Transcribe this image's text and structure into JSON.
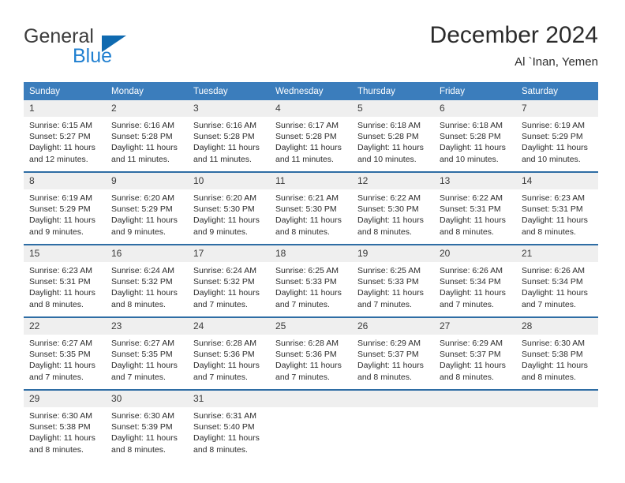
{
  "brand": {
    "name_part1": "General",
    "name_part2": "Blue",
    "logo_icon": "triangle-flag-icon"
  },
  "header": {
    "title": "December 2024",
    "subtitle": "Al `Inan, Yemen"
  },
  "colors": {
    "header_blue": "#3b7dbc",
    "separator_blue": "#2e6da4",
    "daynum_band": "#efefef",
    "brand_blue": "#1f7fd0",
    "logo_blue": "#0f6ab0",
    "text": "#2c2c2c"
  },
  "weekday_headers": [
    "Sunday",
    "Monday",
    "Tuesday",
    "Wednesday",
    "Thursday",
    "Friday",
    "Saturday"
  ],
  "weeks": [
    [
      {
        "day": "1",
        "sunrise": "Sunrise: 6:15 AM",
        "sunset": "Sunset: 5:27 PM",
        "daylight_line1": "Daylight: 11 hours",
        "daylight_line2": "and 12 minutes."
      },
      {
        "day": "2",
        "sunrise": "Sunrise: 6:16 AM",
        "sunset": "Sunset: 5:28 PM",
        "daylight_line1": "Daylight: 11 hours",
        "daylight_line2": "and 11 minutes."
      },
      {
        "day": "3",
        "sunrise": "Sunrise: 6:16 AM",
        "sunset": "Sunset: 5:28 PM",
        "daylight_line1": "Daylight: 11 hours",
        "daylight_line2": "and 11 minutes."
      },
      {
        "day": "4",
        "sunrise": "Sunrise: 6:17 AM",
        "sunset": "Sunset: 5:28 PM",
        "daylight_line1": "Daylight: 11 hours",
        "daylight_line2": "and 11 minutes."
      },
      {
        "day": "5",
        "sunrise": "Sunrise: 6:18 AM",
        "sunset": "Sunset: 5:28 PM",
        "daylight_line1": "Daylight: 11 hours",
        "daylight_line2": "and 10 minutes."
      },
      {
        "day": "6",
        "sunrise": "Sunrise: 6:18 AM",
        "sunset": "Sunset: 5:28 PM",
        "daylight_line1": "Daylight: 11 hours",
        "daylight_line2": "and 10 minutes."
      },
      {
        "day": "7",
        "sunrise": "Sunrise: 6:19 AM",
        "sunset": "Sunset: 5:29 PM",
        "daylight_line1": "Daylight: 11 hours",
        "daylight_line2": "and 10 minutes."
      }
    ],
    [
      {
        "day": "8",
        "sunrise": "Sunrise: 6:19 AM",
        "sunset": "Sunset: 5:29 PM",
        "daylight_line1": "Daylight: 11 hours",
        "daylight_line2": "and 9 minutes."
      },
      {
        "day": "9",
        "sunrise": "Sunrise: 6:20 AM",
        "sunset": "Sunset: 5:29 PM",
        "daylight_line1": "Daylight: 11 hours",
        "daylight_line2": "and 9 minutes."
      },
      {
        "day": "10",
        "sunrise": "Sunrise: 6:20 AM",
        "sunset": "Sunset: 5:30 PM",
        "daylight_line1": "Daylight: 11 hours",
        "daylight_line2": "and 9 minutes."
      },
      {
        "day": "11",
        "sunrise": "Sunrise: 6:21 AM",
        "sunset": "Sunset: 5:30 PM",
        "daylight_line1": "Daylight: 11 hours",
        "daylight_line2": "and 8 minutes."
      },
      {
        "day": "12",
        "sunrise": "Sunrise: 6:22 AM",
        "sunset": "Sunset: 5:30 PM",
        "daylight_line1": "Daylight: 11 hours",
        "daylight_line2": "and 8 minutes."
      },
      {
        "day": "13",
        "sunrise": "Sunrise: 6:22 AM",
        "sunset": "Sunset: 5:31 PM",
        "daylight_line1": "Daylight: 11 hours",
        "daylight_line2": "and 8 minutes."
      },
      {
        "day": "14",
        "sunrise": "Sunrise: 6:23 AM",
        "sunset": "Sunset: 5:31 PM",
        "daylight_line1": "Daylight: 11 hours",
        "daylight_line2": "and 8 minutes."
      }
    ],
    [
      {
        "day": "15",
        "sunrise": "Sunrise: 6:23 AM",
        "sunset": "Sunset: 5:31 PM",
        "daylight_line1": "Daylight: 11 hours",
        "daylight_line2": "and 8 minutes."
      },
      {
        "day": "16",
        "sunrise": "Sunrise: 6:24 AM",
        "sunset": "Sunset: 5:32 PM",
        "daylight_line1": "Daylight: 11 hours",
        "daylight_line2": "and 8 minutes."
      },
      {
        "day": "17",
        "sunrise": "Sunrise: 6:24 AM",
        "sunset": "Sunset: 5:32 PM",
        "daylight_line1": "Daylight: 11 hours",
        "daylight_line2": "and 7 minutes."
      },
      {
        "day": "18",
        "sunrise": "Sunrise: 6:25 AM",
        "sunset": "Sunset: 5:33 PM",
        "daylight_line1": "Daylight: 11 hours",
        "daylight_line2": "and 7 minutes."
      },
      {
        "day": "19",
        "sunrise": "Sunrise: 6:25 AM",
        "sunset": "Sunset: 5:33 PM",
        "daylight_line1": "Daylight: 11 hours",
        "daylight_line2": "and 7 minutes."
      },
      {
        "day": "20",
        "sunrise": "Sunrise: 6:26 AM",
        "sunset": "Sunset: 5:34 PM",
        "daylight_line1": "Daylight: 11 hours",
        "daylight_line2": "and 7 minutes."
      },
      {
        "day": "21",
        "sunrise": "Sunrise: 6:26 AM",
        "sunset": "Sunset: 5:34 PM",
        "daylight_line1": "Daylight: 11 hours",
        "daylight_line2": "and 7 minutes."
      }
    ],
    [
      {
        "day": "22",
        "sunrise": "Sunrise: 6:27 AM",
        "sunset": "Sunset: 5:35 PM",
        "daylight_line1": "Daylight: 11 hours",
        "daylight_line2": "and 7 minutes."
      },
      {
        "day": "23",
        "sunrise": "Sunrise: 6:27 AM",
        "sunset": "Sunset: 5:35 PM",
        "daylight_line1": "Daylight: 11 hours",
        "daylight_line2": "and 7 minutes."
      },
      {
        "day": "24",
        "sunrise": "Sunrise: 6:28 AM",
        "sunset": "Sunset: 5:36 PM",
        "daylight_line1": "Daylight: 11 hours",
        "daylight_line2": "and 7 minutes."
      },
      {
        "day": "25",
        "sunrise": "Sunrise: 6:28 AM",
        "sunset": "Sunset: 5:36 PM",
        "daylight_line1": "Daylight: 11 hours",
        "daylight_line2": "and 7 minutes."
      },
      {
        "day": "26",
        "sunrise": "Sunrise: 6:29 AM",
        "sunset": "Sunset: 5:37 PM",
        "daylight_line1": "Daylight: 11 hours",
        "daylight_line2": "and 8 minutes."
      },
      {
        "day": "27",
        "sunrise": "Sunrise: 6:29 AM",
        "sunset": "Sunset: 5:37 PM",
        "daylight_line1": "Daylight: 11 hours",
        "daylight_line2": "and 8 minutes."
      },
      {
        "day": "28",
        "sunrise": "Sunrise: 6:30 AM",
        "sunset": "Sunset: 5:38 PM",
        "daylight_line1": "Daylight: 11 hours",
        "daylight_line2": "and 8 minutes."
      }
    ],
    [
      {
        "day": "29",
        "sunrise": "Sunrise: 6:30 AM",
        "sunset": "Sunset: 5:38 PM",
        "daylight_line1": "Daylight: 11 hours",
        "daylight_line2": "and 8 minutes."
      },
      {
        "day": "30",
        "sunrise": "Sunrise: 6:30 AM",
        "sunset": "Sunset: 5:39 PM",
        "daylight_line1": "Daylight: 11 hours",
        "daylight_line2": "and 8 minutes."
      },
      {
        "day": "31",
        "sunrise": "Sunrise: 6:31 AM",
        "sunset": "Sunset: 5:40 PM",
        "daylight_line1": "Daylight: 11 hours",
        "daylight_line2": "and 8 minutes."
      },
      {
        "day": "",
        "sunrise": "",
        "sunset": "",
        "daylight_line1": "",
        "daylight_line2": ""
      },
      {
        "day": "",
        "sunrise": "",
        "sunset": "",
        "daylight_line1": "",
        "daylight_line2": ""
      },
      {
        "day": "",
        "sunrise": "",
        "sunset": "",
        "daylight_line1": "",
        "daylight_line2": ""
      },
      {
        "day": "",
        "sunrise": "",
        "sunset": "",
        "daylight_line1": "",
        "daylight_line2": ""
      }
    ]
  ]
}
